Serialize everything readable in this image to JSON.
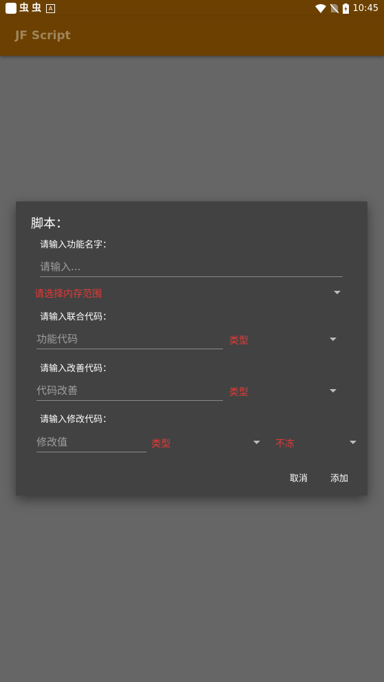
{
  "status_bar": {
    "glyph1": "虫",
    "glyph2": "虫",
    "badge": "A",
    "battery": "",
    "time": "10:45"
  },
  "app_bar": {
    "title": "JF Script"
  },
  "dialog": {
    "title": "脚本：",
    "function_name": {
      "label": "请输入功能名字：",
      "placeholder": "请输入..."
    },
    "memory_range": {
      "value": "请选择内存范围"
    },
    "joint_code": {
      "label": "请输入联合代码：",
      "placeholder": "功能代码",
      "type_value": "类型"
    },
    "improve_code": {
      "label": "请输入改善代码：",
      "placeholder": "代码改善",
      "type_value": "类型"
    },
    "modify_code": {
      "label": "请输入修改代码：",
      "placeholder": "修改值",
      "type_value": "类型",
      "freeze_value": "不冻"
    },
    "buttons": {
      "cancel": "取消",
      "add": "添加"
    }
  }
}
